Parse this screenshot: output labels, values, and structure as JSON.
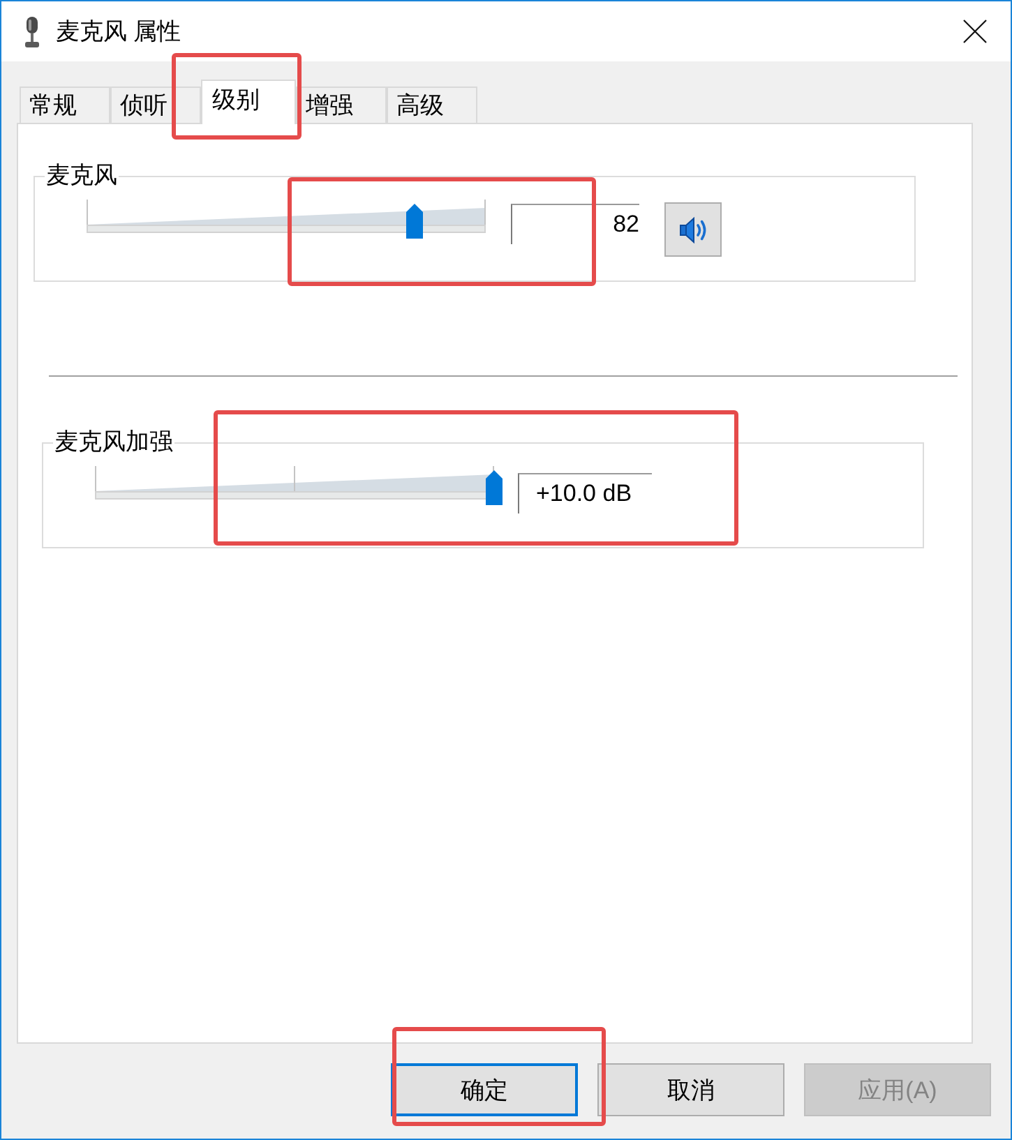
{
  "window": {
    "title": "麦克风 属性"
  },
  "tabs": [
    {
      "label": "常规",
      "selected": false,
      "highlighted": false
    },
    {
      "label": "侦听",
      "selected": false,
      "highlighted": false
    },
    {
      "label": "级别",
      "selected": true,
      "highlighted": true
    },
    {
      "label": "增强",
      "selected": false,
      "highlighted": false
    },
    {
      "label": "高级",
      "selected": false,
      "highlighted": false
    }
  ],
  "levels": [
    {
      "kind": "volume",
      "label": "麦克风",
      "level": 0.82,
      "value": "82",
      "muted": false,
      "highlighted": true
    },
    {
      "kind": "boost",
      "label": "麦克风加强",
      "level": 1,
      "value": "+10.0 dB",
      "highlighted": true
    }
  ],
  "buttons": [
    {
      "label": "确定",
      "default": true,
      "disabled": false,
      "highlighted": true
    },
    {
      "label": "取消",
      "default": false,
      "disabled": false,
      "highlighted": false
    },
    {
      "label": "应用(A)",
      "default": false,
      "disabled": true,
      "highlighted": false
    }
  ]
}
